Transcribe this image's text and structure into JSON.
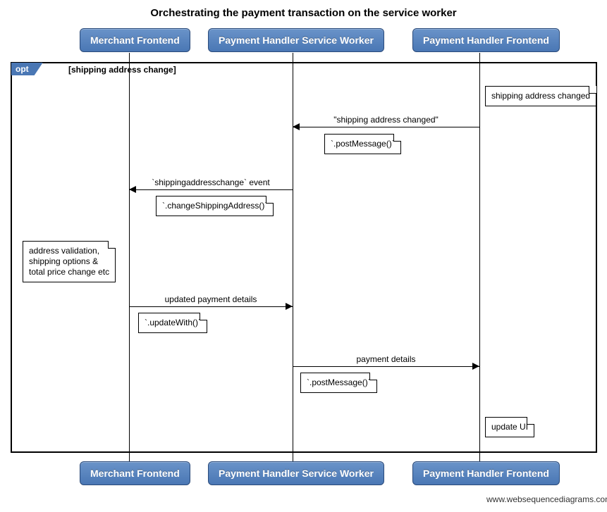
{
  "title": "Orchestrating the payment transaction on the service worker",
  "participants": {
    "merchant": "Merchant Frontend",
    "worker": "Payment Handler Service Worker",
    "frontend": "Payment Handler Frontend"
  },
  "opt": {
    "label": "opt",
    "guard": "[shipping address change]"
  },
  "notes": {
    "shippingChangedTop": "shipping address changed",
    "postMessage1": "`.postMessage()`",
    "changeShipping": "`.changeShippingAddress()`",
    "addressValidation": "address validation,\nshipping options &\ntotal price change etc",
    "updateWith": "`.updateWith()`",
    "postMessage2": "`.postMessage()`",
    "updateUI": "update UI"
  },
  "messages": {
    "shippingChanged": "\"shipping address changed\"",
    "shippingEvent": "`shippingaddresschange` event",
    "updatedDetails": "updated payment details",
    "paymentDetails": "payment details"
  },
  "watermark": "www.websequencediagrams.com"
}
